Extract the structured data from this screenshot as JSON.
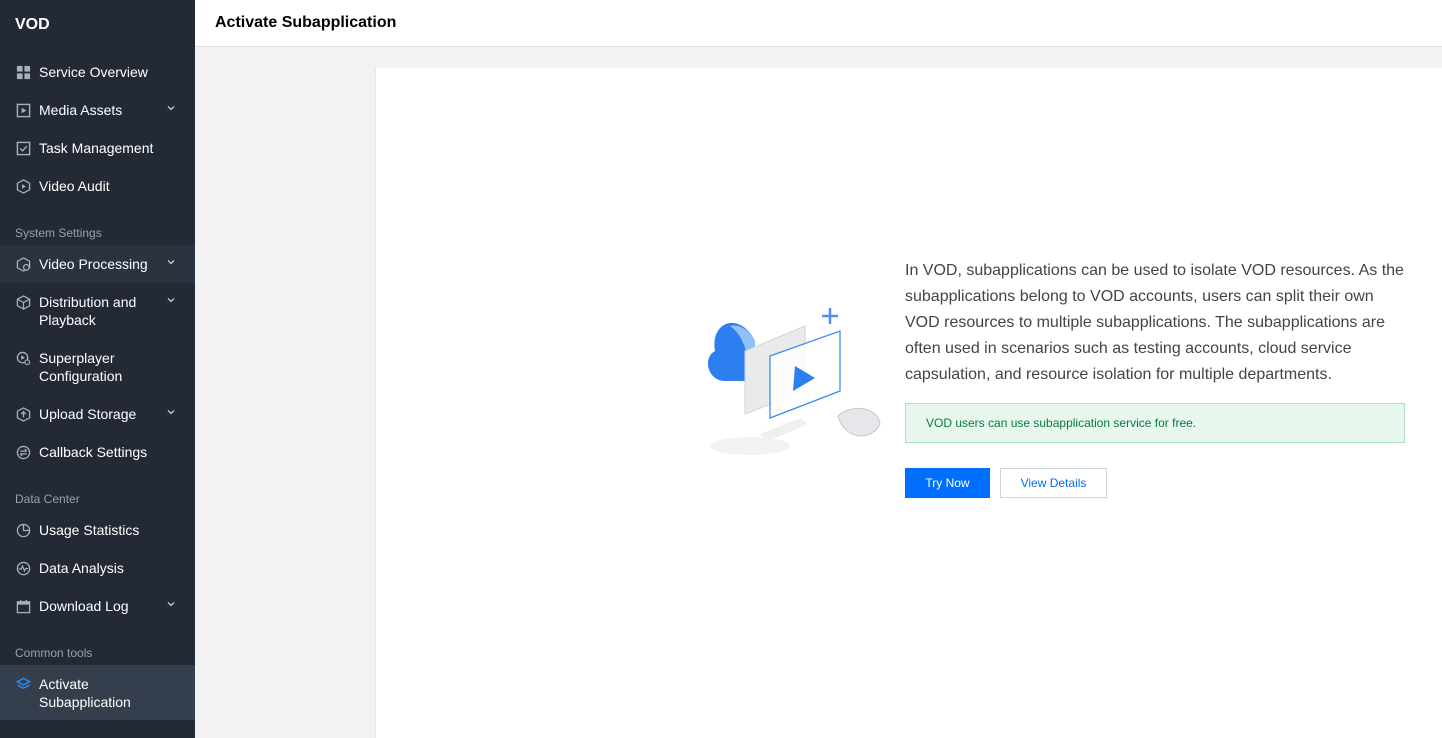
{
  "sidebar": {
    "brand": "VOD",
    "items": [
      {
        "label": "Service Overview"
      },
      {
        "label": "Media Assets"
      },
      {
        "label": "Task Management"
      },
      {
        "label": "Video Audit"
      },
      {
        "label": "Video Processing"
      },
      {
        "label": "Distribution and Playback"
      },
      {
        "label": "Superplayer Configuration"
      },
      {
        "label": "Upload Storage"
      },
      {
        "label": "Callback Settings"
      },
      {
        "label": "Usage Statistics"
      },
      {
        "label": "Data Analysis"
      },
      {
        "label": "Download Log"
      },
      {
        "label": "Activate Subapplication"
      }
    ],
    "sections": {
      "system": "System Settings",
      "data": "Data Center",
      "tools": "Common tools"
    }
  },
  "header": {
    "title": "Activate Subapplication"
  },
  "main": {
    "description": "In VOD, subapplications can be used to isolate VOD resources. As the subapplications belong to VOD accounts, users can split their own VOD resources to multiple subapplications. The subapplications are often used in scenarios such as testing accounts, cloud service capsulation, and resource isolation for multiple departments.",
    "notice": "VOD users can use subapplication service for free.",
    "try_now": "Try Now",
    "view_details": "View Details"
  },
  "colors": {
    "sidebar_bg": "#232a35",
    "primary": "#006eff",
    "success_bg": "#e8f7ee",
    "success_text": "#0b7a3b"
  }
}
